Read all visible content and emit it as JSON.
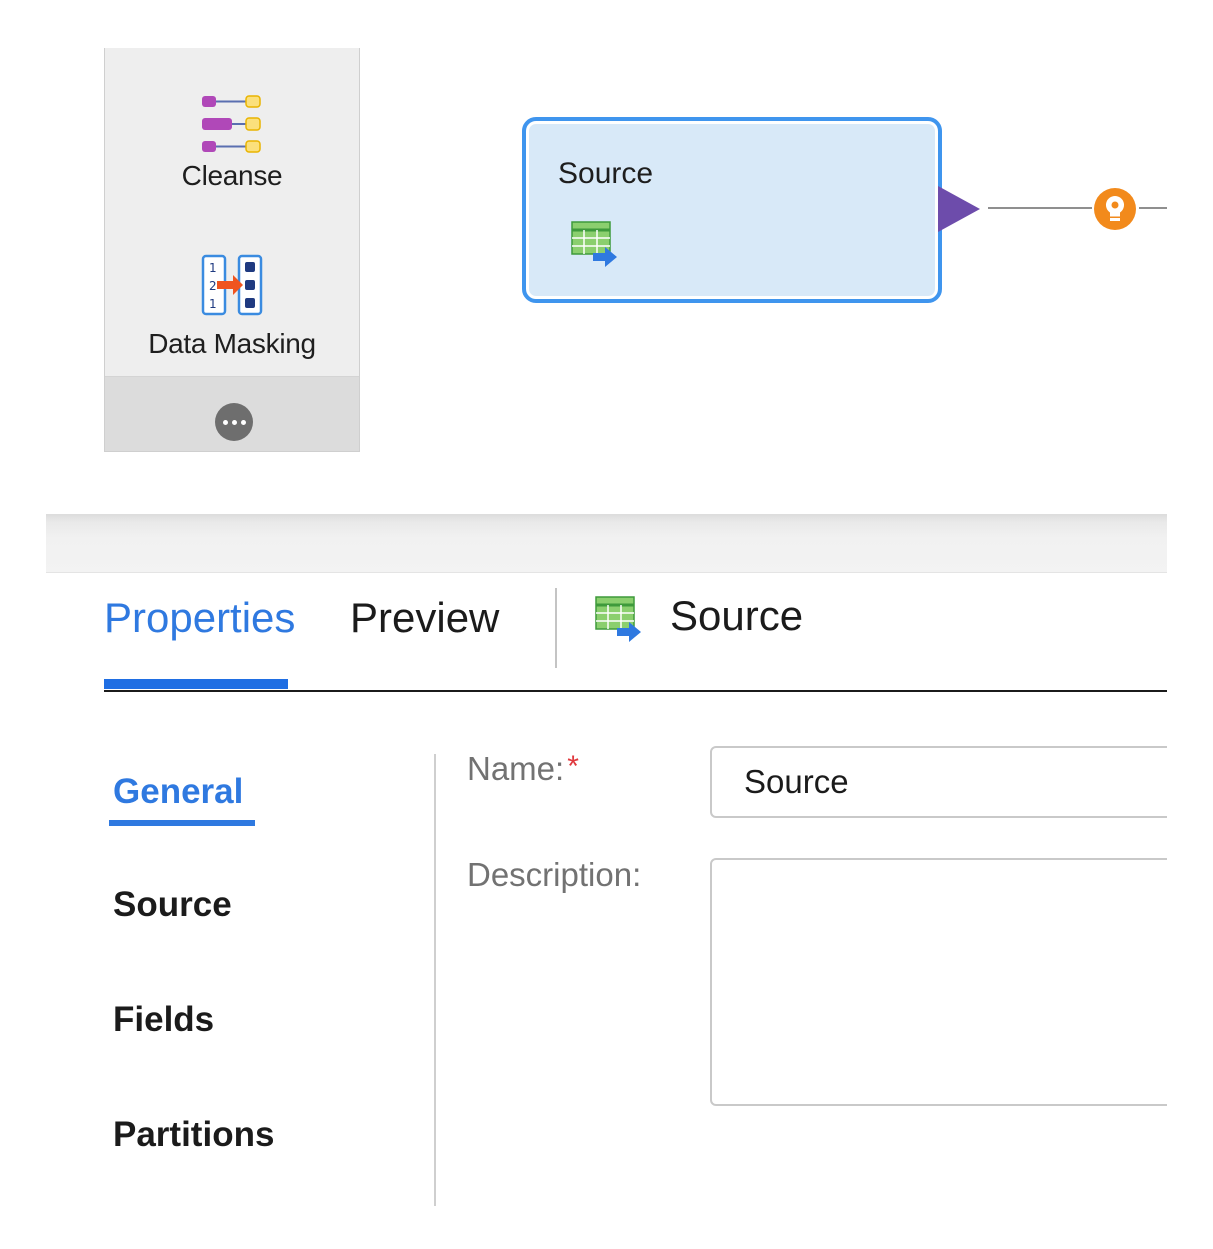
{
  "palette": {
    "items": [
      {
        "label": "Cleanse",
        "icon": "cleanse-icon"
      },
      {
        "label": "Data Masking",
        "icon": "data-masking-icon"
      }
    ],
    "more_icon": "more-options-icon"
  },
  "canvas": {
    "node": {
      "title": "Source",
      "icon": "source-table-icon",
      "border_color": "#3f95ee",
      "fill_color": "#d8e9f8"
    },
    "port_color": "#6d4cab",
    "link_icon": "lightbulb-icon",
    "link_icon_color": "#f28a1c"
  },
  "tabs": {
    "items": [
      {
        "label": "Properties",
        "active": true
      },
      {
        "label": "Preview",
        "active": false
      }
    ],
    "context_label": "Source",
    "context_icon": "source-table-icon",
    "accent": "#2f79e0"
  },
  "side_nav": {
    "items": [
      {
        "label": "General",
        "active": true
      },
      {
        "label": "Source",
        "active": false
      },
      {
        "label": "Fields",
        "active": false
      },
      {
        "label": "Partitions",
        "active": false
      }
    ]
  },
  "form": {
    "name_label": "Name:",
    "required_mark": "*",
    "name_value": "Source",
    "description_label": "Description:",
    "description_value": ""
  }
}
